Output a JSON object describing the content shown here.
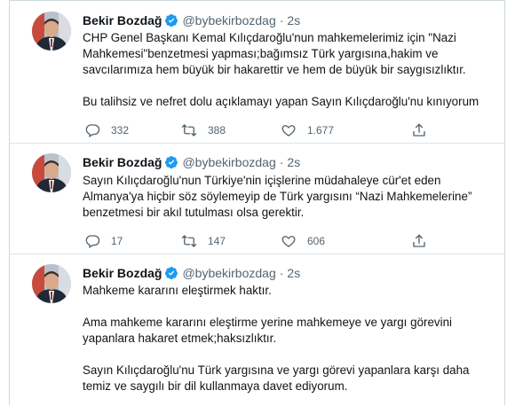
{
  "colors": {
    "text": "#0f1419",
    "secondary": "#536471",
    "verified": "#1d9bf0",
    "border": "#cfd9de"
  },
  "tweets": [
    {
      "author": {
        "name": "Bekir Bozdağ",
        "handle": "@bybekirbozdag",
        "separator": "·",
        "time": "2s",
        "verified": true
      },
      "paragraphs": [
        "CHP Genel Başkanı Kemal Kılıçdaroğlu'nun mahkemelerimiz için \"Nazi\nMahkemesi\"benzetmesi yapması;bağımsız Türk yargısına,hakim ve\nsavcılarımıza hem büyük bir hakarettir ve hem de büyük bir saygısızlıktır.",
        "Bu talihsiz ve nefret dolu açıklamayı yapan Sayın Kılıçdaroğlu'nu kınıyorum"
      ],
      "stats": {
        "replies": "332",
        "retweets": "388",
        "likes": "1.677"
      }
    },
    {
      "author": {
        "name": "Bekir Bozdağ",
        "handle": "@bybekirbozdag",
        "separator": "·",
        "time": "2s",
        "verified": true
      },
      "paragraphs": [
        "Sayın Kılıçdaroğlu'nun Türkiye'nin içişlerine müdahaleye cür'et eden\nAlmanya'ya hiçbir söz söylemeyip de Türk yargısını “Nazi Mahkemelerine”\nbenzetmesi bir akıl tutulması olsa gerektir."
      ],
      "stats": {
        "replies": "17",
        "retweets": "147",
        "likes": "606"
      }
    },
    {
      "author": {
        "name": "Bekir Bozdağ",
        "handle": "@bybekirbozdag",
        "separator": "·",
        "time": "2s",
        "verified": true
      },
      "paragraphs": [
        "Mahkeme kararını eleştirmek haktır.",
        "Ama mahkeme kararını eleştirme yerine mahkemeye ve yargı görevini\nyapanlara hakaret etmek;haksızlıktır.",
        "Sayın Kılıçdaroğlu'nu Türk yargısına ve yargı görevi yapanlara karşı daha\ntemiz ve saygılı bir dil kullanmaya davet ediyorum."
      ]
    }
  ]
}
